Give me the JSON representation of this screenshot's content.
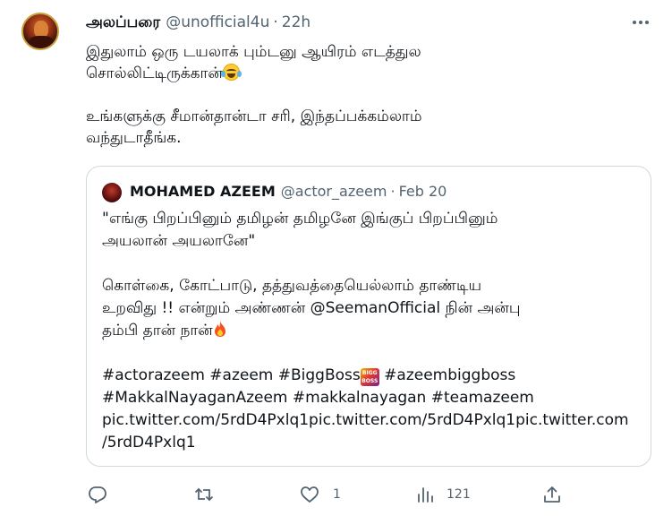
{
  "tweet": {
    "display_name": "அலப்பரை",
    "handle": "@unofficial4u",
    "separator": "·",
    "time": "22h",
    "text_line1": "இதுலாம் ஒரு டயலாக் பும்டனு ஆயிரம் எடத்துல",
    "text_line2": "சொல்லிட்டிருக்கான்",
    "text_para2": "உங்களுக்கு சீமான்தான்டா சரி, இந்தப்பக்கம்லாம்\nவந்துடாதீங்க."
  },
  "quoted": {
    "display_name": "MOHAMED AZEEM",
    "handle": "@actor_azeem",
    "separator": "·",
    "date": "Feb 20",
    "para1": "\"எங்கு பிறப்பினும் தமிழன் தமிழனே இங்குப் பிறப்பினும்\nஅயலான் அயலானே\"",
    "para2_a": "கொள்கை, கோட்பாடு, தத்துவத்தையெல்லாம் தாண்டிய\nஉறவிது !! என்றும் அண்ணன் @SeemanOfficial நின் அன்பு\nதம்பி தான் நான்",
    "tags_a": "#actorazeem  #azeem #BiggBoss",
    "bigg_badge": "BIGG BOSS",
    "tags_b": " #azeembiggboss",
    "tags_rest": "#MakkalNayaganAzeem #makkalnayagan #teamazeem\npic.twitter.com/5rdD4Pxlq1pic.twitter.com/5rdD4Pxlq1pic.twitter.com\n/5rdD4Pxlq1"
  },
  "actions": {
    "reply_count": "",
    "retweet_count": "",
    "like_count": "1",
    "views_count": "121"
  },
  "icons": {
    "more": "more-icon",
    "reply": "reply-icon",
    "retweet": "retweet-icon",
    "like": "like-icon",
    "views": "views-icon",
    "share": "share-icon"
  },
  "colors": {
    "text": "#0f1419",
    "secondary": "#536471",
    "border": "#cfd9de"
  }
}
